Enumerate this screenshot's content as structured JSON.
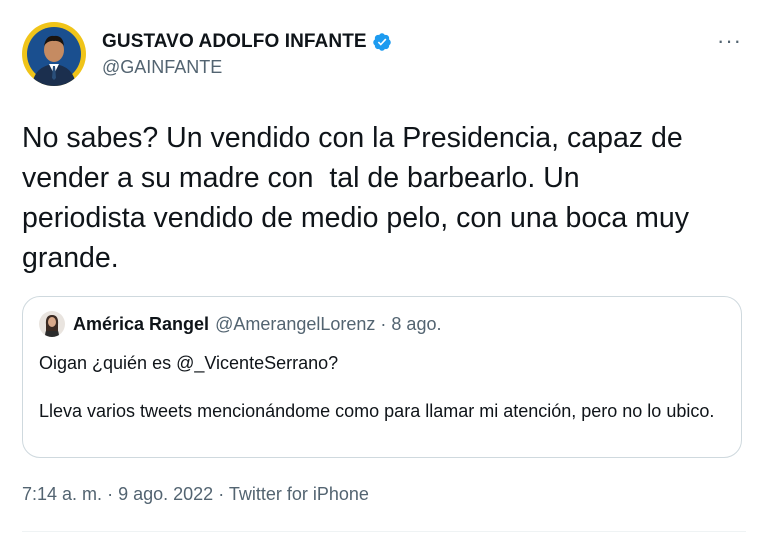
{
  "author": {
    "display_name": "GUSTAVO ADOLFO INFANTE",
    "handle": "@GAINFANTE",
    "avatar_icon": "profile-photo",
    "verified_icon": "verified-badge-icon",
    "verified_color": "#1d9bf0"
  },
  "more_label": "···",
  "tweet_text": "No sabes? Un vendido con la Presidencia, capaz de\nvender a su madre con  tal de barbearlo. Un\nperiodista vendido de medio pelo, con una boca muy\ngrande.",
  "quoted": {
    "display_name": "América Rangel",
    "handle": "@AmerangelLorenz",
    "separator": "·",
    "date": "8 ago.",
    "line1": "Oigan ¿quién es @_VicenteSerrano?",
    "line2": "Lleva varios tweets mencionándome como para llamar mi atención, pero no lo ubico."
  },
  "meta": {
    "time": "7:14 a. m.",
    "separator1": "·",
    "date": "9 ago. 2022",
    "separator2": "·",
    "source": "Twitter for iPhone"
  },
  "colors": {
    "primary_text": "#0f1419",
    "secondary_text": "#536471",
    "border": "#cfd9de",
    "accent": "#1d9bf0"
  }
}
